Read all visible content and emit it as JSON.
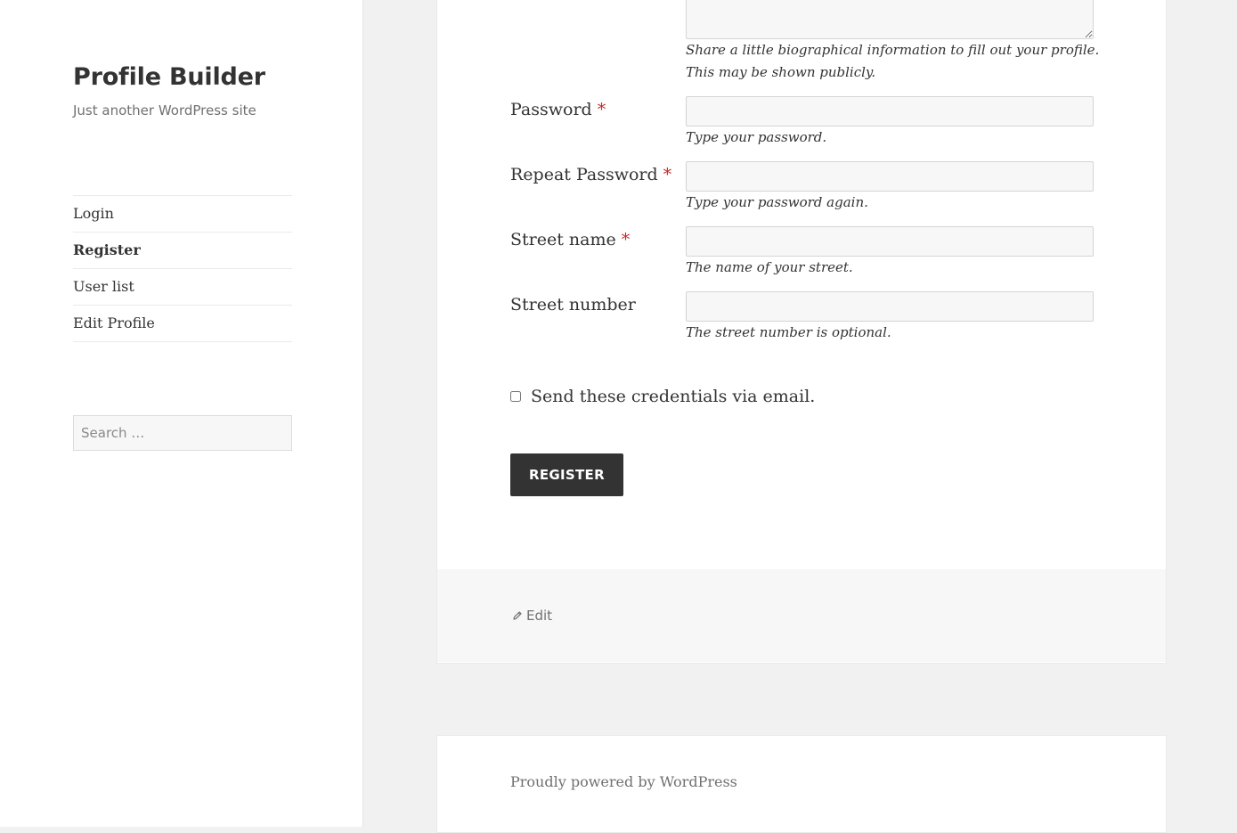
{
  "site": {
    "title": "Profile Builder",
    "description": "Just another WordPress site"
  },
  "nav": {
    "items": [
      {
        "label": "Login"
      },
      {
        "label": "Register"
      },
      {
        "label": "User list"
      },
      {
        "label": "Edit Profile"
      }
    ],
    "current": "Register"
  },
  "search": {
    "placeholder": "Search …"
  },
  "form": {
    "bio": {
      "help_line1": "Share a little biographical information to fill out your profile.",
      "help_line2": "This may be shown publicly.",
      "value": ""
    },
    "password": {
      "label": "Password",
      "required_mark": "*",
      "value": "",
      "help": "Type your password."
    },
    "repeat_password": {
      "label": "Repeat Password",
      "required_mark": "*",
      "value": "",
      "help": "Type your password again."
    },
    "street_name": {
      "label": "Street name",
      "required_mark": "*",
      "value": "",
      "help": "The name of your street."
    },
    "street_number": {
      "label": "Street number",
      "value": "",
      "help": "The street number is optional."
    },
    "send_credentials": {
      "label": "Send these credentials via email.",
      "checked": false
    },
    "submit_label": "REGISTER"
  },
  "entry_footer": {
    "edit_label": "Edit",
    "edit_icon": "pencil-icon"
  },
  "footer": {
    "powered_by": "Proudly powered by WordPress"
  },
  "colors": {
    "required": "#c62828",
    "button_bg": "#333333",
    "background": "#f1f1f1"
  }
}
